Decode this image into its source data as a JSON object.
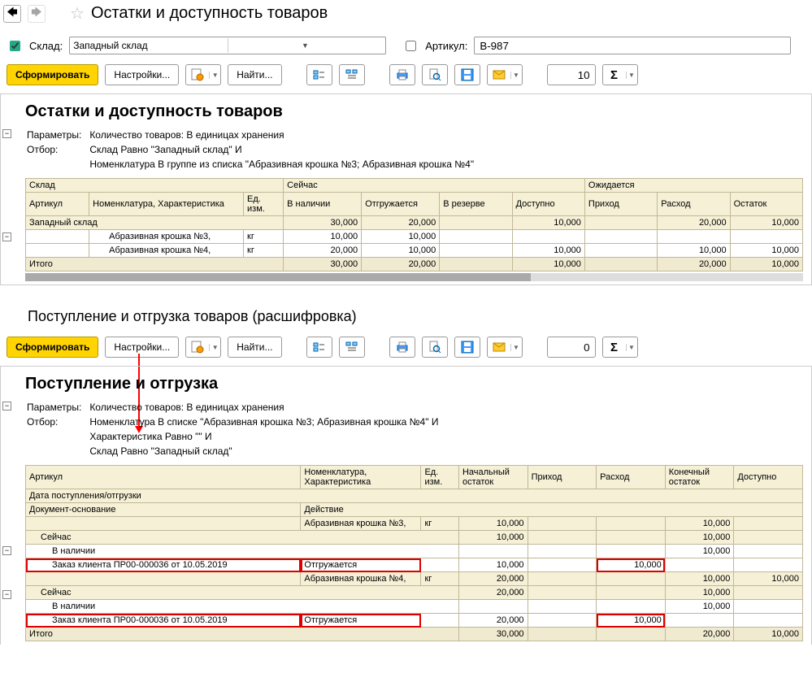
{
  "header": {
    "title": "Остатки и доступность товаров"
  },
  "filters": {
    "warehouse_label": "Склад:",
    "warehouse_value": "Западный склад",
    "article_label": "Артикул:",
    "article_value": "B-987"
  },
  "toolbar": {
    "generate": "Сформировать",
    "settings": "Настройки...",
    "find": "Найти...",
    "count1": "10",
    "count2": "0"
  },
  "report1": {
    "title": "Остатки и доступность товаров",
    "params_label": "Параметры:",
    "params_value": "Количество товаров: В единицах хранения",
    "filter_label": "Отбор:",
    "filter_value1": "Склад Равно \"Западный склад\" И",
    "filter_value2": "Номенклатура В группе из списка \"Абразивная крошка №3; Абразивная крошка №4\"",
    "cols": {
      "warehouse": "Склад",
      "now": "Сейчас",
      "expected": "Ожидается",
      "article": "Артикул",
      "nomenclature": "Номенклатура, Характеристика",
      "unit": "Ед. изм.",
      "onhand": "В наличии",
      "shipping": "Отгружается",
      "reserved": "В резерве",
      "available": "Доступно",
      "income": "Приход",
      "outcome": "Расход",
      "remainder": "Остаток"
    },
    "group": "Западный склад",
    "rows": [
      {
        "name": "Абразивная крошка №3,",
        "unit": "кг",
        "onhand": "10,000",
        "ship": "10,000",
        "reserved": "",
        "avail": "",
        "in": "",
        "out": "",
        "rem": ""
      },
      {
        "name": "Абразивная крошка №4,",
        "unit": "кг",
        "onhand": "20,000",
        "ship": "10,000",
        "reserved": "",
        "avail": "10,000",
        "in": "",
        "out": "10,000",
        "rem": "10,000"
      }
    ],
    "group_totals": {
      "onhand": "30,000",
      "ship": "20,000",
      "avail": "10,000",
      "out": "20,000",
      "rem": "10,000"
    },
    "total_label": "Итого",
    "totals": {
      "onhand": "30,000",
      "ship": "20,000",
      "avail": "10,000",
      "out": "20,000",
      "rem": "10,000"
    }
  },
  "sub_header": "Поступление и отгрузка товаров (расшифровка)",
  "report2": {
    "title": "Поступление и отгрузка",
    "params_label": "Параметры:",
    "params_value": "Количество товаров: В единицах хранения",
    "filter_label": "Отбор:",
    "filter1": "Номенклатура В списке \"Абразивная крошка №3; Абразивная крошка №4\" И",
    "filter2": "Характеристика Равно \"\" И",
    "filter3": "Склад Равно \"Западный склад\"",
    "cols": {
      "article": "Артикул",
      "nom": "Номенклатура, Характеристика",
      "unit": "Ед. изм.",
      "begin": "Начальный остаток",
      "in": "Приход",
      "out": "Расход",
      "end": "Конечный остаток",
      "avail": "Доступно",
      "date": "Дата поступления/отгрузки",
      "doc": "Документ-основание",
      "action": "Действие"
    },
    "now_label": "Сейчас",
    "onhand_label": "В наличии",
    "order_label": "Заказ клиента ПР00-000036 от 10.05.2019",
    "ship_action": "Отгружается",
    "item1": {
      "name": "Абразивная крошка №3,",
      "unit": "кг",
      "begin": "10,000",
      "end": "10,000",
      "now_b": "10,000",
      "now_e": "10,000",
      "onhand_e": "10,000",
      "order_b": "10,000",
      "order_out": "10,000"
    },
    "item2": {
      "name": "Абразивная крошка №4,",
      "unit": "кг",
      "begin": "20,000",
      "end": "10,000",
      "avail": "10,000",
      "now_b": "20,000",
      "now_e": "10,000",
      "onhand_e": "10,000",
      "order_b": "20,000",
      "order_out": "10,000"
    },
    "total_label": "Итого",
    "totals": {
      "begin": "30,000",
      "end": "20,000",
      "avail": "10,000"
    }
  }
}
